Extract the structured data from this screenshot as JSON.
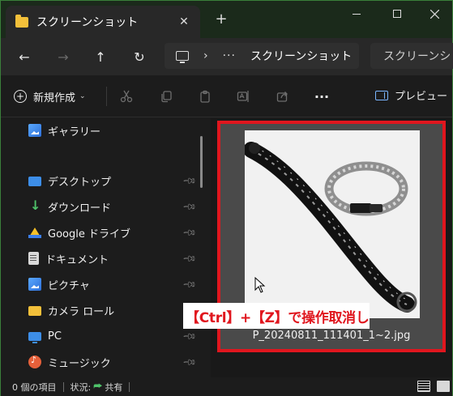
{
  "window": {
    "tab_title": "スクリーンショット",
    "close_tab_glyph": "✕",
    "new_tab_glyph": "+",
    "accent_border": "#3a7f3a"
  },
  "address_bar": {
    "back": "←",
    "forward": "→",
    "up": "↑",
    "refresh": "↻",
    "chevron": "›",
    "ellipsis": "···",
    "crumb": "スクリーンショット",
    "search_placeholder": "スクリーンショット"
  },
  "command_bar": {
    "new_label": "新規作成",
    "new_chevron": "⌄",
    "more": "···",
    "preview_label": "プレビュー",
    "icons": [
      "cut-icon",
      "copy-icon",
      "paste-icon",
      "rename-icon",
      "share-icon"
    ]
  },
  "sidebar": {
    "items": [
      {
        "label": "ギャラリー",
        "icon": "gallery-icon",
        "pinned": false
      },
      {
        "label": "デスクトップ",
        "icon": "desktop-icon",
        "pinned": true
      },
      {
        "label": "ダウンロード",
        "icon": "download-icon",
        "pinned": true
      },
      {
        "label": "Google ドライブ",
        "icon": "google-drive-icon",
        "pinned": true
      },
      {
        "label": "ドキュメント",
        "icon": "documents-icon",
        "pinned": true
      },
      {
        "label": "ピクチャ",
        "icon": "pictures-icon",
        "pinned": true
      },
      {
        "label": "カメラ ロール",
        "icon": "folder-icon",
        "pinned": true
      },
      {
        "label": "PC",
        "icon": "pc-icon",
        "pinned": true
      },
      {
        "label": "ミュージック",
        "icon": "music-icon",
        "pinned": true
      }
    ]
  },
  "content": {
    "file_name": "P_20240811_111401_1~2.jpg",
    "highlight_color": "#e0161e",
    "annotation": "【Ctrl】+【Z】で操作取消し"
  },
  "status_bar": {
    "count": "0 個の項目",
    "state_label": "状況:",
    "share_label": "共有"
  }
}
